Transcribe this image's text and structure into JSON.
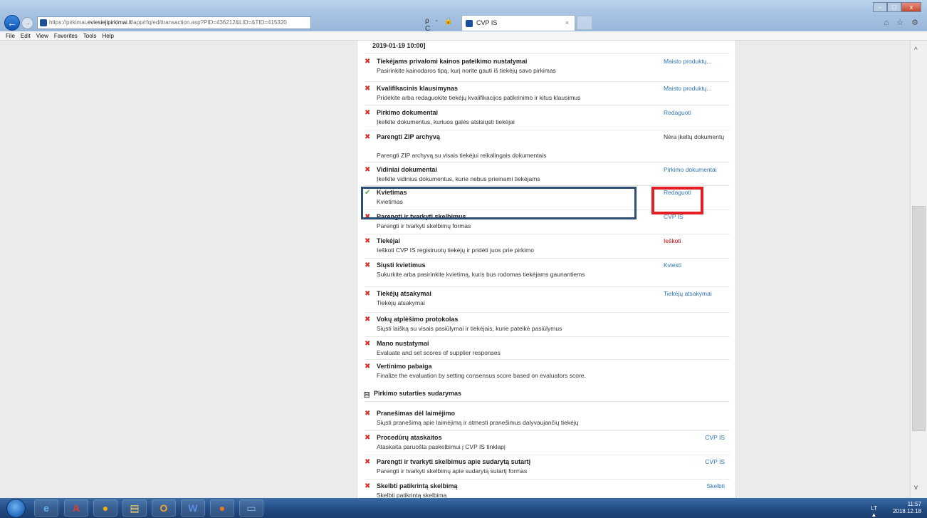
{
  "browser": {
    "url_prefix": "https://pirkimai.",
    "url_domain": "eviesiejipirkimai.lt",
    "url_suffix": "/app/rfq/edittransaction.asp?PID=436212&LID=&TID=415320",
    "addr_tools": "ρ - 🔒 C",
    "tab_title": "CVP IS",
    "tab_close": "×",
    "back": "←",
    "forward": "→",
    "right_icons": "⌂ ☆ ⚙",
    "win_min": "–",
    "win_max": "□",
    "win_close": "x"
  },
  "menu": [
    "File",
    "Edit",
    "View",
    "Favorites",
    "Tools",
    "Help"
  ],
  "page": {
    "date_line": "2019-01-19 10:00]",
    "rows": [
      {
        "mark": "✖",
        "status": "x",
        "title": "Tiekėjams privalomi kainos pateikimo nustatymai",
        "desc": "Pasirinkite kainodaros tipą, kurį norite gauti iš tiekėjų savo pirkimas",
        "link": "Maisto produktų...",
        "link_style": "link"
      },
      {
        "mark": "✖",
        "status": "x",
        "title": "Kvalifikacinis klausimynas",
        "desc": "Pridėkite arba redaguokite tiekėjų kvalifikacijos patikrinimo ir kitus klausimus",
        "link": "Maisto produktų...",
        "link_style": "link"
      },
      {
        "mark": "✖",
        "status": "x",
        "title": "Pirkimo dokumentai",
        "desc": "Įkelkite dokumentus, kuriuos galės atsisiųsti tiekėjai",
        "link": "Redaguoti",
        "link_style": "link"
      },
      {
        "mark": "✖",
        "status": "x",
        "title": "Parengti ZIP archyvą",
        "desc": "",
        "link": "Nėra įkeltų dokumentų",
        "link_style": "plain"
      },
      {
        "mark": "",
        "status": "none",
        "title": "",
        "desc": "Parengti ZIP archyvą su visais tiekėjui reikalingais dokumentais",
        "link": "",
        "link_style": "link"
      },
      {
        "mark": "✖",
        "status": "x",
        "title": "Vidiniai dokumentai",
        "desc": "Įkelkite vidinius dokumentus, kurie nebus prieinami tiekėjams",
        "link": "Pirkimo dokumentai",
        "link_style": "link"
      },
      {
        "mark": "✔",
        "status": "ok",
        "title": "Kvietimas",
        "desc": "Kvietimas",
        "link": "Redaguoti",
        "link_style": "link"
      },
      {
        "mark": "✖",
        "status": "x",
        "title": "Parengti ir tvarkyti skelbimus",
        "desc": "Parengti ir tvarkyti skelbimų formas",
        "link": "CVP IS",
        "link_style": "link"
      },
      {
        "mark": "✖",
        "status": "x",
        "title": "Tiekėjai",
        "desc": "Ieškoti CVP IS registruotų tiekėjų ir pridėti juos prie pirkimo",
        "link": "Ieškoti",
        "link_style": "red"
      },
      {
        "mark": "✖",
        "status": "x",
        "title": "Siųsti kvietimus",
        "desc": "Sukurkite arba pasirinkite kvietimą, kuris bus rodomas tiekėjams gaunantiems",
        "link": "Kviesti",
        "link_style": "link"
      },
      {
        "mark": "✖",
        "status": "x",
        "title": "Tiekėjų atsakymai",
        "desc": "Tiekėjų atsakymai",
        "link": "Tiekėjų atsakymai",
        "link_style": "link"
      },
      {
        "mark": "✖",
        "status": "x",
        "title": "Vokų atplėšimo protokolas",
        "desc": "Siųsti laišką su visais pasiūlymai ir tiekėjais, kurie pateikė pasiūlymus",
        "link": "",
        "link_style": "link"
      },
      {
        "mark": "✖",
        "status": "x",
        "title": "Mano nustatymai",
        "desc": "Evaluate and set scores of supplier responses",
        "link": "",
        "link_style": "link"
      },
      {
        "mark": "✖",
        "status": "x",
        "title": "Vertinimo pabaiga",
        "desc": "Finalize the evaluation by setting consensus score based on evaluators score.",
        "link": "",
        "link_style": "link"
      }
    ],
    "section_box": "⊟",
    "section_title": "Pirkimo sutarties sudarymas",
    "rows2": [
      {
        "mark": "✖",
        "status": "x",
        "title": "Pranešimas dėl laimėjimo",
        "desc": "Siųsti pranešimą apie laimėjimą ir atmesti pranešimus dalyvaujančių tiekėjų",
        "link": ""
      },
      {
        "mark": "✖",
        "status": "x",
        "title": "Procedūrų ataskaitos",
        "desc": "Ataskaita paruošta paskelbimui į CVP IS tinklapį",
        "link": "CVP IS"
      },
      {
        "mark": "✖",
        "status": "x",
        "title": "Parengti ir tvarkyti skelbimus apie sudarytą sutartį",
        "desc": "Parengti ir tvarkyti skelbimų apie sudarytą sutartį formas",
        "link": "CVP IS"
      },
      {
        "mark": "✖",
        "status": "x",
        "title": "Skelbti patikrintą skelbimą",
        "desc": "Skelbti patikrintą skelbimą",
        "link": "Skelbti"
      }
    ]
  },
  "scroll": {
    "up": "^",
    "down": "v"
  },
  "taskbar": {
    "icons": [
      {
        "name": "internet-explorer",
        "glyph": "e",
        "color": "#5fb0f5"
      },
      {
        "name": "acrobat-reader",
        "glyph": "A",
        "color": "#e03b30"
      },
      {
        "name": "chrome",
        "glyph": "●",
        "color": "#f0b400"
      },
      {
        "name": "file-explorer",
        "glyph": "▤",
        "color": "#f3d36a"
      },
      {
        "name": "outlook",
        "glyph": "O",
        "color": "#f4a52b"
      },
      {
        "name": "word",
        "glyph": "W",
        "color": "#5b8de0"
      },
      {
        "name": "firefox",
        "glyph": "●",
        "color": "#f07a1d"
      },
      {
        "name": "remote-desktop",
        "glyph": "▭",
        "color": "#8fb8e0"
      }
    ],
    "lang": "LT",
    "tray_arrow": "▲",
    "time": "11:57",
    "date": "2018.12.18"
  }
}
